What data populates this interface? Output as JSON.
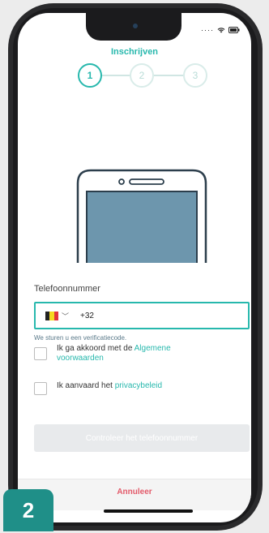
{
  "header": {
    "title": "Inschrijven"
  },
  "steps": [
    {
      "label": "1",
      "state": "active"
    },
    {
      "label": "2",
      "state": "inactive"
    },
    {
      "label": "3",
      "state": "inactive"
    }
  ],
  "phone_field": {
    "label": "Telefoonnummer",
    "country_flag": "belgium-flag",
    "prefix": "+32",
    "hint": "We sturen u een verificatiecode."
  },
  "terms": {
    "prefix": "Ik ga akkoord met de ",
    "link": "Algemene voorwaarden"
  },
  "privacy": {
    "prefix": "Ik aanvaard het ",
    "link": "privacybeleid"
  },
  "buttons": {
    "verify": "Controleer het telefoonnummer",
    "cancel": "Annuleer"
  },
  "badge": "2",
  "colors": {
    "accent": "#27b8ad",
    "cancel": "#e35a6a",
    "badge": "#1f8f88",
    "disabled_button": "#e8eaec"
  }
}
